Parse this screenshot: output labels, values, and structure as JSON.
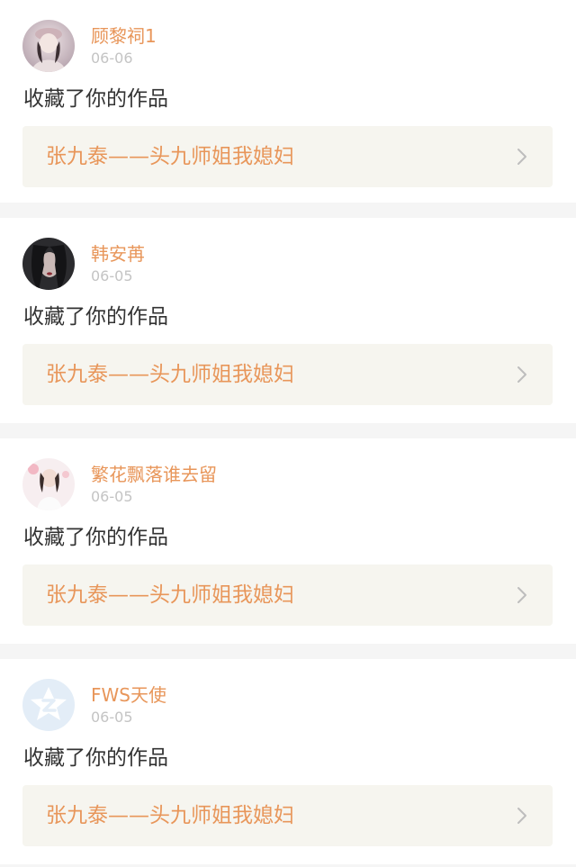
{
  "colors": {
    "accent": "#e8965a",
    "date": "#c4c4c4",
    "text": "#333333",
    "link_bg": "#f6f5ef",
    "divider": "#f5f5f5"
  },
  "notifications": [
    {
      "username": "顾黎祠1",
      "date": "06-06",
      "action": "收藏了你的作品",
      "work_title": "张九泰——头九师姐我媳妇",
      "avatar": "user-photo-avatar"
    },
    {
      "username": "韩安苒",
      "date": "06-05",
      "action": "收藏了你的作品",
      "work_title": "张九泰——头九师姐我媳妇",
      "avatar": "user-photo-avatar"
    },
    {
      "username": "繁花飘落谁去留",
      "date": "06-05",
      "action": "收藏了你的作品",
      "work_title": "张九泰——头九师姐我媳妇",
      "avatar": "user-photo-avatar"
    },
    {
      "username": "FWS天使",
      "date": "06-05",
      "action": "收藏了你的作品",
      "work_title": "张九泰——头九师姐我媳妇",
      "avatar": "default-qzone-avatar"
    }
  ],
  "icons": {
    "chevron": "chevron-right-icon"
  }
}
